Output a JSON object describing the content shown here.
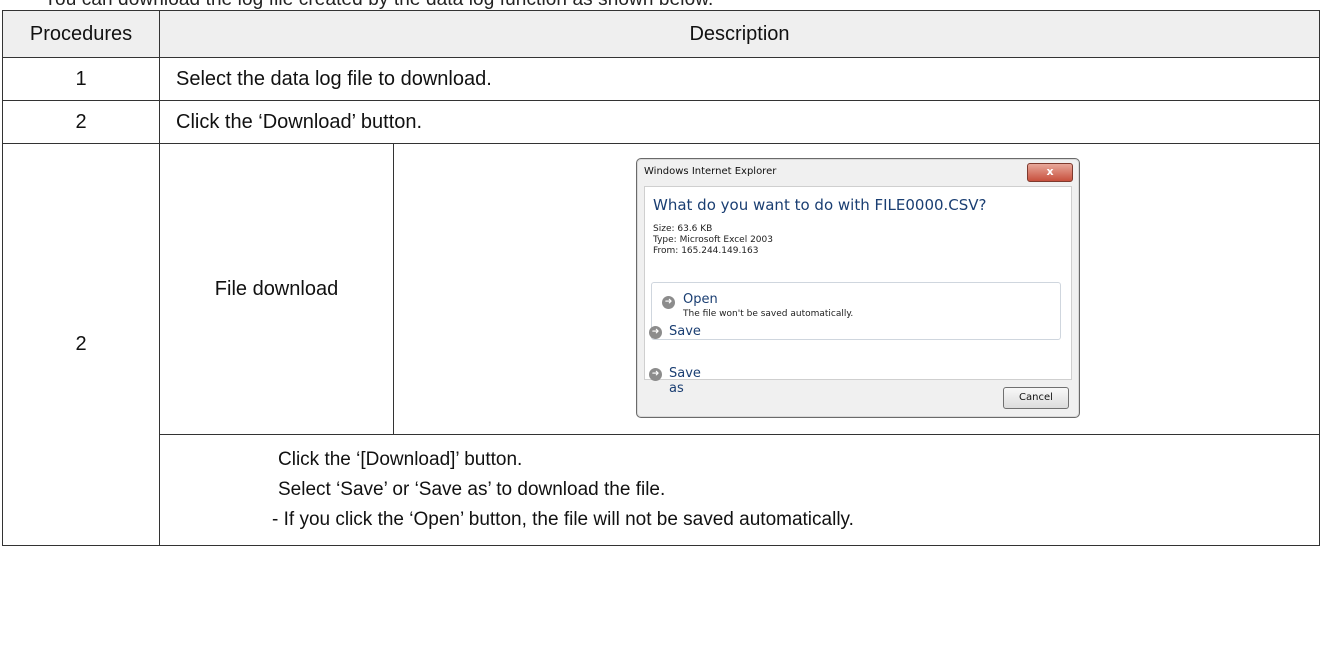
{
  "top_fragment": "You can download the log file created by the data log function as shown below.",
  "table": {
    "headers": [
      "Procedures",
      "Description"
    ],
    "rows": [
      {
        "step": "1",
        "text": "Select the data log file to download."
      },
      {
        "step": "2",
        "text": "Click the ‘Download’ button."
      }
    ],
    "step3": {
      "step": "2",
      "label": "File download",
      "notes": [
        "Click the ‘[Download]’ button.",
        "Select ‘Save’ or ‘Save as’ to download the file.",
        "- If you click the ‘Open’ button, the file will not be saved automatically."
      ]
    }
  },
  "dialog": {
    "title": "Windows Internet Explorer",
    "close": "x",
    "question": "What do you want to do with FILE0000.CSV?",
    "size": "Size: 63.6 KB",
    "type": "Type: Microsoft Excel 2003",
    "from": "From: 165.244.149.163",
    "open_label": "Open",
    "open_sub": "The file won't be saved automatically.",
    "save_label": "Save",
    "saveas_label": "Save as",
    "cancel_label": "Cancel",
    "arrow_icon": "arrow-right-circle-icon"
  }
}
